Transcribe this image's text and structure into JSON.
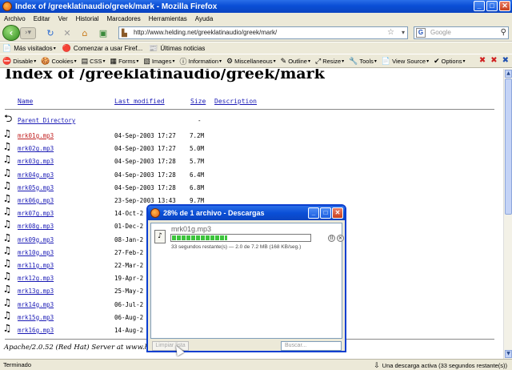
{
  "window": {
    "title": "Index of /greeklatinaudio/greek/mark - Mozilla Firefox",
    "minimize": "_",
    "maximize": "□",
    "close": "✕"
  },
  "menu": [
    "Archivo",
    "Editar",
    "Ver",
    "Historial",
    "Marcadores",
    "Herramientas",
    "Ayuda"
  ],
  "nav": {
    "url": "http://www.helding.net/greeklatinaudio/greek/mark/",
    "search_placeholder": "Google"
  },
  "bookmarks": [
    {
      "icon": "📄",
      "label": "Más visitados",
      "dropdown": true
    },
    {
      "icon": "🔴",
      "label": "Comenzar a usar Firef...",
      "dropdown": false
    },
    {
      "icon": "📰",
      "label": "Últimas noticias",
      "dropdown": false
    }
  ],
  "devbar": [
    {
      "icon": "⛔",
      "label": "Disable"
    },
    {
      "icon": "🍪",
      "label": "Cookies"
    },
    {
      "icon": "▤",
      "label": "CSS"
    },
    {
      "icon": "▦",
      "label": "Forms"
    },
    {
      "icon": "▧",
      "label": "Images"
    },
    {
      "icon": "ⓘ",
      "label": "Information"
    },
    {
      "icon": "⚙",
      "label": "Miscellaneous"
    },
    {
      "icon": "✎",
      "label": "Outline"
    },
    {
      "icon": "⤢",
      "label": "Resize"
    },
    {
      "icon": "🔧",
      "label": "Tools"
    },
    {
      "icon": "📄",
      "label": "View Source"
    },
    {
      "icon": "✔",
      "label": "Options"
    }
  ],
  "page": {
    "heading": "Index of /greeklatinaudio/greek/mark",
    "columns": {
      "name": "Name",
      "modified": "Last modified",
      "size": "Size",
      "description": "Description"
    },
    "parent": {
      "label": "Parent Directory",
      "size": "-"
    },
    "files": [
      {
        "name": "mrk01g.mp3",
        "date": "04-Sep-2003 17:27",
        "size": "7.2M",
        "visited": true
      },
      {
        "name": "mrk02g.mp3",
        "date": "04-Sep-2003 17:27",
        "size": "5.0M",
        "visited": false
      },
      {
        "name": "mrk03g.mp3",
        "date": "04-Sep-2003 17:28",
        "size": "5.7M",
        "visited": false
      },
      {
        "name": "mrk04g.mp3",
        "date": "04-Sep-2003 17:28",
        "size": "6.4M",
        "visited": false
      },
      {
        "name": "mrk05g.mp3",
        "date": "04-Sep-2003 17:28",
        "size": "6.8M",
        "visited": false
      },
      {
        "name": "mrk06g.mp3",
        "date": "23-Sep-2003 13:43",
        "size": "9.7M",
        "visited": false
      },
      {
        "name": "mrk07g.mp3",
        "date": "14-Oct-2",
        "size": "",
        "visited": false
      },
      {
        "name": "mrk08g.mp3",
        "date": "01-Dec-2",
        "size": "",
        "visited": false
      },
      {
        "name": "mrk09g.mp3",
        "date": "08-Jan-2",
        "size": "",
        "visited": false
      },
      {
        "name": "mrk10g.mp3",
        "date": "27-Feb-2",
        "size": "",
        "visited": false
      },
      {
        "name": "mrk11g.mp3",
        "date": "22-Mar-2",
        "size": "",
        "visited": false
      },
      {
        "name": "mrk12g.mp3",
        "date": "19-Apr-2",
        "size": "",
        "visited": false
      },
      {
        "name": "mrk13g.mp3",
        "date": "25-May-2",
        "size": "",
        "visited": false
      },
      {
        "name": "mrk14g.mp3",
        "date": "06-Jul-2",
        "size": "",
        "visited": false
      },
      {
        "name": "mrk15g.mp3",
        "date": "06-Aug-2",
        "size": "",
        "visited": false
      },
      {
        "name": "mrk16g.mp3",
        "date": "14-Aug-2",
        "size": "",
        "visited": false
      }
    ],
    "footer": "Apache/2.0.52 (Red Hat) Server at www.held"
  },
  "status": {
    "left": "Terminado",
    "right": "Una descarga activa (33 segundos restante(s))"
  },
  "downloads": {
    "title": "28% de 1 archivo - Descargas",
    "file": "mrk01g.mp3",
    "progress_fraction": 0.4,
    "status": "33 segundos restante(s) — 2.0 de 7.2 MB (168 KB/seg.)",
    "clear_label": "Limpiar lista",
    "search_placeholder": "Buscar..."
  }
}
